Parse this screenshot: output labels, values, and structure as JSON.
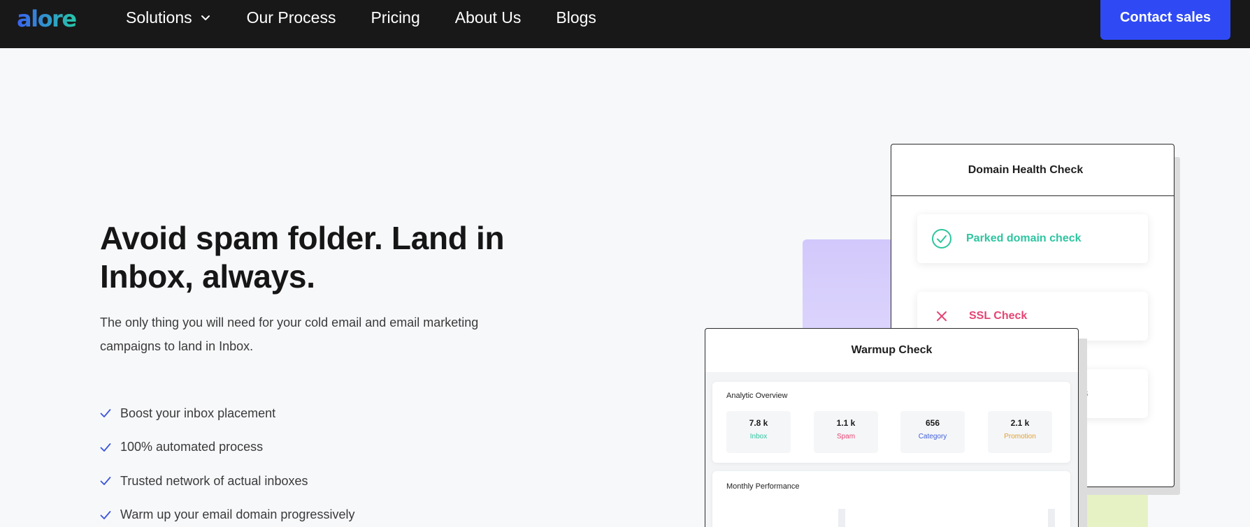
{
  "nav": {
    "logo": "alore",
    "links": [
      "Solutions",
      "Our Process",
      "Pricing",
      "About Us",
      "Blogs"
    ],
    "cta": "Contact sales"
  },
  "hero": {
    "title": "Avoid spam folder. Land in Inbox, always.",
    "subtitle": "The only thing you will need for your cold email and email marketing campaigns to land in Inbox.",
    "features": [
      "Boost your inbox placement",
      "100% automated process",
      "Trusted network of actual inboxes",
      "Warm up your email domain progressively"
    ]
  },
  "domain_health": {
    "title": "Domain Health Check",
    "checks": [
      {
        "label": "Parked domain check",
        "status": "pass",
        "color": "#2ec5a0",
        "icon": "check-circle-icon"
      },
      {
        "label": "SSL Check",
        "status": "fail",
        "color": "#e64573",
        "icon": "close-icon"
      },
      {
        "label": "s",
        "status": "warn",
        "color": "#e0a030",
        "icon": "warning-icon"
      }
    ]
  },
  "warmup": {
    "title": "Warmup Check",
    "analytic_title": "Analytic Overview",
    "stats": [
      {
        "value": "7.8 k",
        "label": "Inbox",
        "color": "#2ec5a0"
      },
      {
        "value": "1.1 k",
        "label": "Spam",
        "color": "#e64573"
      },
      {
        "value": "656",
        "label": "Category",
        "color": "#3f5fd8"
      },
      {
        "value": "2.1 k",
        "label": "Promotion",
        "color": "#e0a030"
      }
    ],
    "monthly_title": "Monthly Performance"
  },
  "colors": {
    "nav_bg": "#181818",
    "accent": "#2f4af5",
    "check_blue": "#3b55d9"
  }
}
